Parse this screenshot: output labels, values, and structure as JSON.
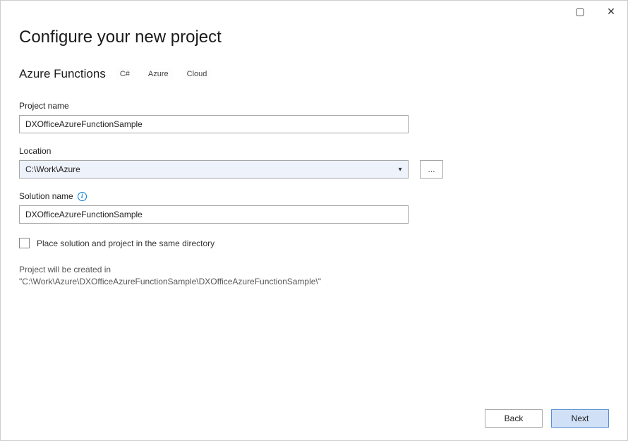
{
  "titlebar": {
    "maximize_glyph": "▢",
    "close_glyph": "✕"
  },
  "header": {
    "title": "Configure your new project",
    "template_name": "Azure Functions",
    "tags": [
      "C#",
      "Azure",
      "Cloud"
    ]
  },
  "fields": {
    "project_name": {
      "label": "Project name",
      "value": "DXOfficeAzureFunctionSample"
    },
    "location": {
      "label": "Location",
      "value": "C:\\Work\\Azure",
      "browse_label": "..."
    },
    "solution_name": {
      "label": "Solution name",
      "value": "DXOfficeAzureFunctionSample",
      "info_glyph": "i"
    },
    "same_directory": {
      "label": "Place solution and project in the same directory",
      "checked": false
    }
  },
  "creation_message": "Project will be created in \"C:\\Work\\Azure\\DXOfficeAzureFunctionSample\\DXOfficeAzureFunctionSample\\\"",
  "footer": {
    "back": "Back",
    "next": "Next"
  }
}
